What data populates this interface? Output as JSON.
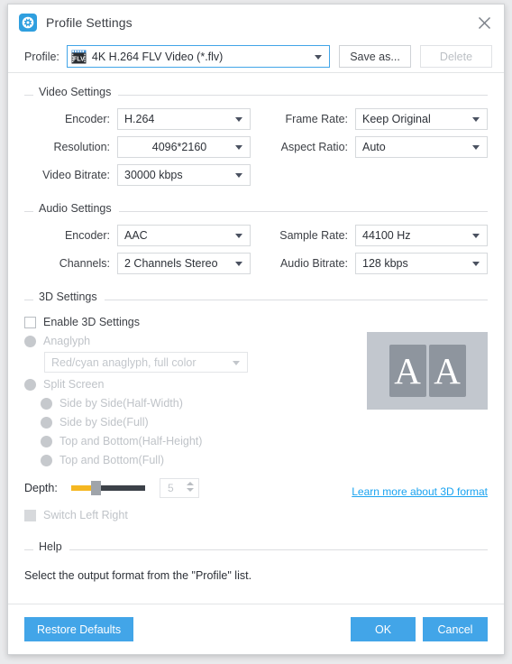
{
  "window": {
    "title": "Profile Settings",
    "app_icon": "film-reel-icon",
    "close_icon": "close-icon"
  },
  "profile_bar": {
    "label": "Profile:",
    "selected": "4K H.264 FLV Video (*.flv)",
    "file_icon": "flv-file-icon",
    "save_as_label": "Save as...",
    "delete_label": "Delete"
  },
  "video_settings": {
    "legend": "Video Settings",
    "fields": [
      {
        "label": "Encoder:",
        "value": "H.264"
      },
      {
        "label": "Resolution:",
        "value": "4096*2160"
      },
      {
        "label": "Video Bitrate:",
        "value": "30000 kbps"
      },
      {
        "label": "Frame Rate:",
        "value": "Keep Original"
      },
      {
        "label": "Aspect Ratio:",
        "value": "Auto"
      }
    ]
  },
  "audio_settings": {
    "legend": "Audio Settings",
    "fields": [
      {
        "label": "Encoder:",
        "value": "AAC"
      },
      {
        "label": "Channels:",
        "value": "2 Channels Stereo"
      },
      {
        "label": "Sample Rate:",
        "value": "44100 Hz"
      },
      {
        "label": "Audio Bitrate:",
        "value": "128 kbps"
      }
    ]
  },
  "three_d_settings": {
    "legend": "3D Settings",
    "enable_label": "Enable 3D Settings",
    "anaglyph_label": "Anaglyph",
    "anaglyph_value": "Red/cyan anaglyph, full color",
    "split_screen_label": "Split Screen",
    "split_options": [
      "Side by Side(Half-Width)",
      "Side by Side(Full)",
      "Top and Bottom(Half-Height)",
      "Top and Bottom(Full)"
    ],
    "depth_label": "Depth:",
    "depth_value": "5",
    "switch_left_right_label": "Switch Left Right",
    "learn_more_label": "Learn more about 3D format",
    "preview_letter_left": "A",
    "preview_letter_right": "A"
  },
  "help": {
    "legend": "Help",
    "text": "Select the output format from the \"Profile\" list."
  },
  "footer": {
    "restore_label": "Restore Defaults",
    "ok_label": "OK",
    "cancel_label": "Cancel"
  },
  "colors": {
    "accent": "#42a5e8",
    "link": "#1aa3f0",
    "slider_fill": "#f5b721"
  }
}
